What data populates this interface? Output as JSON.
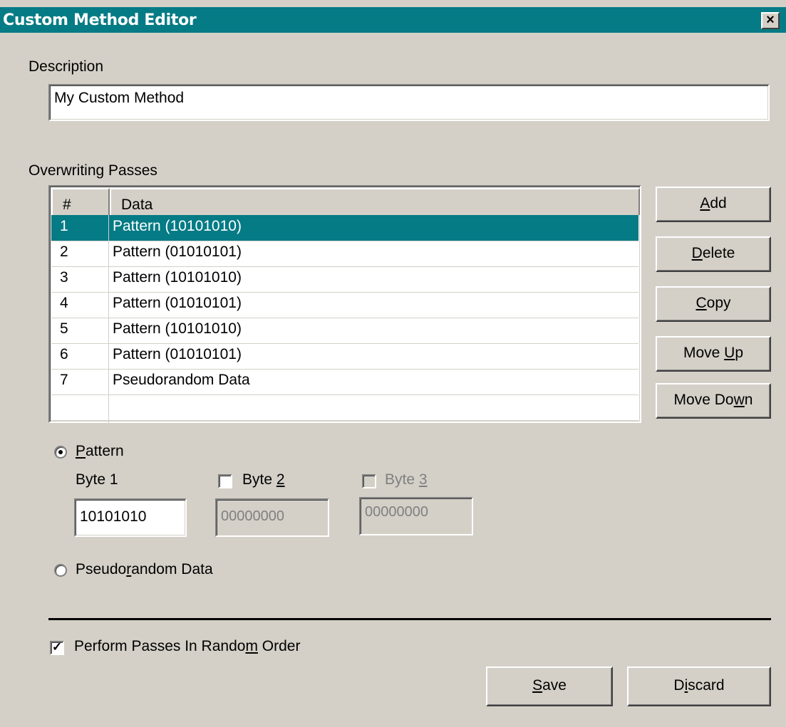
{
  "window": {
    "title": "Custom Method Editor",
    "close": "×"
  },
  "description": {
    "label": "Description",
    "value": "My Custom Method"
  },
  "passes": {
    "label": "Overwriting Passes",
    "columns": [
      "#",
      "Data"
    ],
    "rows": [
      {
        "num": "1",
        "data": "Pattern (10101010)"
      },
      {
        "num": "2",
        "data": "Pattern (01010101)"
      },
      {
        "num": "3",
        "data": "Pattern (10101010)"
      },
      {
        "num": "4",
        "data": "Pattern (01010101)"
      },
      {
        "num": "5",
        "data": "Pattern (10101010)"
      },
      {
        "num": "6",
        "data": "Pattern (01010101)"
      },
      {
        "num": "7",
        "data": "Pseudorandom Data"
      }
    ],
    "selected_row": "1"
  },
  "buttons": {
    "add": "Add",
    "delete": "Delete",
    "copy": "Copy",
    "move_up": "Move Up",
    "move_down": "Move Down",
    "save": "Save",
    "discard": "Discard"
  },
  "pattern": {
    "radio_label": "Pattern",
    "selected": true,
    "byte1": {
      "label": "Byte 1",
      "value": "10101010"
    },
    "byte2": {
      "label": "Byte 2",
      "value": "00000000",
      "checked": false
    },
    "byte3": {
      "label": "Byte 3",
      "value": "00000000",
      "checked": false,
      "disabled": true
    }
  },
  "pseudorandom": {
    "radio_label": "Pseudorandom Data",
    "selected": false
  },
  "random_order": {
    "label": "Perform Passes In Random Order",
    "checked": true
  },
  "colors": {
    "titlebar": "#047b85",
    "face": "#d4d0c8",
    "selection": "#047b85"
  }
}
